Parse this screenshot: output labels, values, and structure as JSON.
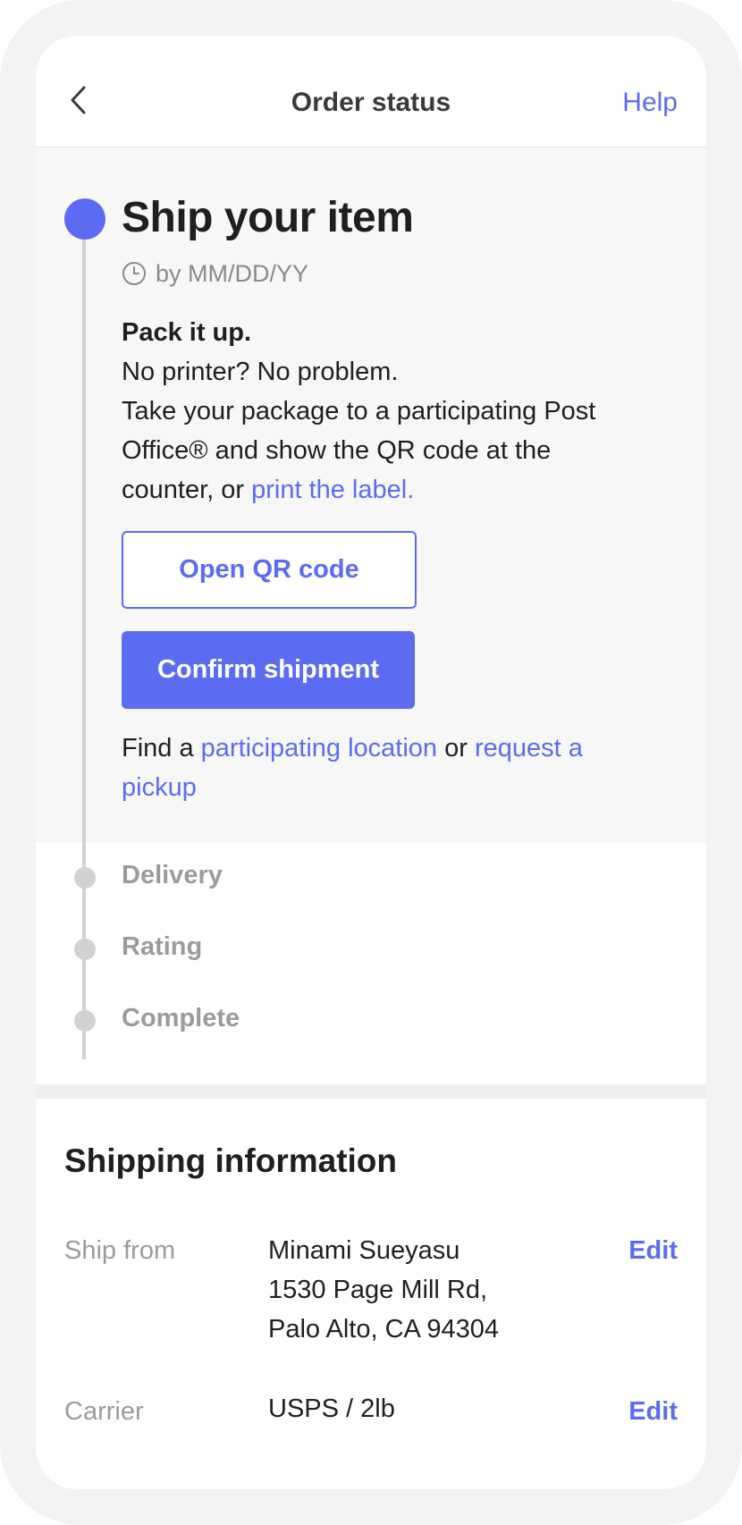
{
  "header": {
    "title": "Order status",
    "help_label": "Help"
  },
  "active_step": {
    "title": "Ship your item",
    "due": "by MM/DD/YY",
    "heading": "Pack it up.",
    "line1": "No printer? No problem.",
    "line2a": "Take your package to a participating Post",
    "line2b": "Office® and show the QR code at the",
    "line2c": "counter, or ",
    "print_link": "print the label.",
    "open_qr_label": "Open QR code",
    "confirm_label": "Confirm shipment",
    "find_prefix": "Find a ",
    "location_link": "participating location",
    "find_or": " or ",
    "pickup_link_1": "request a",
    "pickup_link_2": "pickup"
  },
  "upcoming_steps": [
    "Delivery",
    "Rating",
    "Complete"
  ],
  "shipping": {
    "title": "Shipping information",
    "ship_from_label": "Ship from",
    "ship_from_name": "Minami Sueyasu",
    "ship_from_street": "1530 Page Mill Rd,",
    "ship_from_city": "Palo Alto, CA 94304",
    "carrier_label": "Carrier",
    "carrier_value": "USPS / 2lb",
    "edit_label": "Edit"
  },
  "colors": {
    "accent": "#5b6cf2",
    "muted": "#9b9b9b",
    "timeline": "#d2d2d4"
  },
  "icons": [
    "back-chevron-icon",
    "clock-icon"
  ]
}
